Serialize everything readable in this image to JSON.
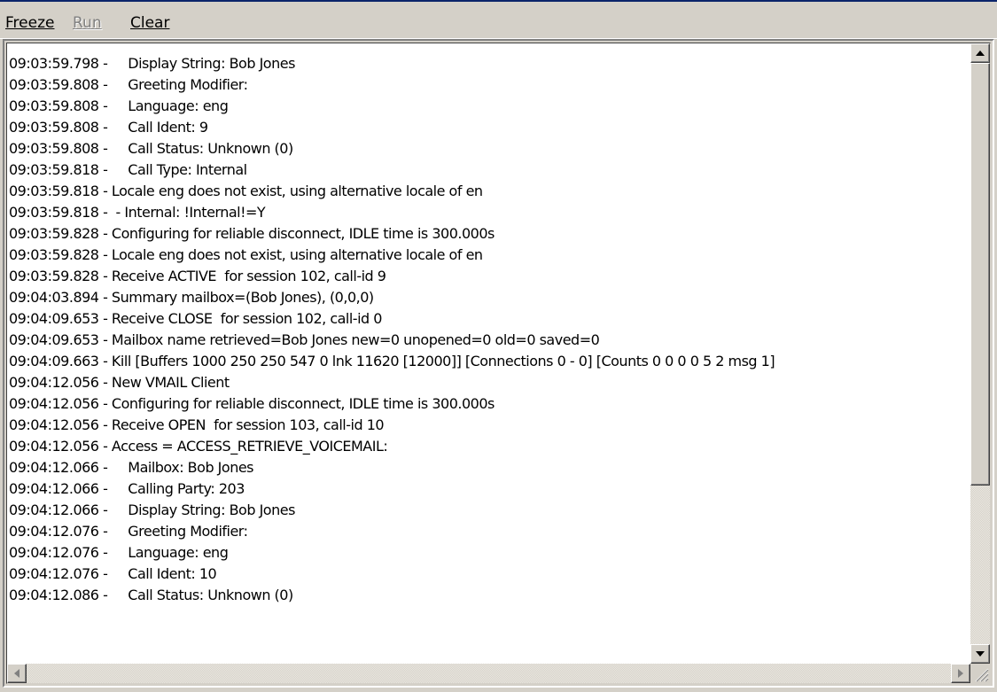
{
  "menu": {
    "freeze_label": "Freeze",
    "run_label": "Run",
    "clear_label": "Clear"
  },
  "log": {
    "lines": [
      "09:03:59.798 -     Display String: Bob Jones",
      "09:03:59.808 -     Greeting Modifier:",
      "09:03:59.808 -     Language: eng",
      "09:03:59.808 -     Call Ident: 9",
      "09:03:59.808 -     Call Status: Unknown (0)",
      "09:03:59.818 -     Call Type: Internal",
      "09:03:59.818 - Locale eng does not exist, using alternative locale of en",
      "09:03:59.818 -  - Internal: !Internal!=Y",
      "09:03:59.828 - Configuring for reliable disconnect, IDLE time is 300.000s",
      "09:03:59.828 - Locale eng does not exist, using alternative locale of en",
      "09:03:59.828 - Receive ACTIVE  for session 102, call-id 9",
      "09:04:03.894 - Summary mailbox=(Bob Jones), (0,0,0)",
      "09:04:09.653 - Receive CLOSE  for session 102, call-id 0",
      "09:04:09.653 - Mailbox name retrieved=Bob Jones new=0 unopened=0 old=0 saved=0",
      "09:04:09.663 - Kill [Buffers 1000 250 250 547 0 lnk 11620 [12000]] [Connections 0 - 0] [Counts 0 0 0 0 5 2 msg 1]",
      "09:04:12.056 - New VMAIL Client",
      "09:04:12.056 - Configuring for reliable disconnect, IDLE time is 300.000s",
      "09:04:12.056 - Receive OPEN  for session 103, call-id 10",
      "09:04:12.056 - Access = ACCESS_RETRIEVE_VOICEMAIL:",
      "09:04:12.066 -     Mailbox: Bob Jones",
      "09:04:12.066 -     Calling Party: 203",
      "09:04:12.066 -     Display String: Bob Jones",
      "09:04:12.076 -     Greeting Modifier:",
      "09:04:12.076 -     Language: eng",
      "09:04:12.076 -     Call Ident: 10",
      "09:04:12.086 -     Call Status: Unknown (0)"
    ]
  },
  "icons": {
    "scroll_up": "arrow-up-icon",
    "scroll_down": "arrow-down-icon",
    "scroll_left": "arrow-left-icon",
    "scroll_right": "arrow-right-icon",
    "size_grip": "resize-grip-icon"
  },
  "colors": {
    "chrome": "#d4d0c8",
    "log_background": "#ffffff",
    "text": "#000000",
    "disabled_text": "#808080"
  }
}
